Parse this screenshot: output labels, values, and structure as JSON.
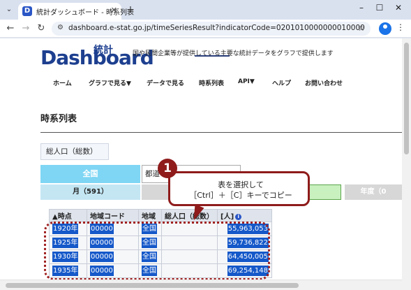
{
  "browser": {
    "tab_title": "統計ダッシュボード - 時系列表",
    "tab_favicon": "D",
    "url": "dashboard.e-stat.go.jp/timeSeriesResult?indicatorCode=0201010000000010000"
  },
  "site": {
    "logo_text": "Dashboard",
    "logo_kanji": "統計",
    "tagline": "国や民間企業等が提供している主要な統計データをグラフで提供します"
  },
  "nav": {
    "items": [
      "ホーム",
      "グラフで見る▼",
      "データで見る",
      "時系列表",
      "API▼",
      "ヘルプ",
      "お問い合わせ"
    ]
  },
  "main": {
    "section_title": "時系列表",
    "data_label": "総人口（総数）",
    "region_button": "全国",
    "pref_select": "都道",
    "period_tabs": [
      "月（591）",
      "",
      "",
      "年度（0"
    ]
  },
  "table": {
    "headers": [
      "▲時点",
      "地域コード",
      "地域",
      "総人口（総数）",
      "[人]"
    ],
    "rows": [
      [
        "1920年",
        "00000",
        "全国",
        "",
        "55,963,053"
      ],
      [
        "1925年",
        "00000",
        "全国",
        "",
        "59,736,822"
      ],
      [
        "1930年",
        "00000",
        "全国",
        "",
        "64,450,005"
      ],
      [
        "1935年",
        "00000",
        "全国",
        "",
        "69,254,148"
      ]
    ]
  },
  "callout": {
    "step": "1",
    "line1": "表を選択して",
    "line2": "［Ctrl］＋［C］キーでコピー"
  },
  "colors": {
    "accent": "#8f1b1b",
    "nation_button": "#7fd6f4",
    "selection": "#1558c9",
    "period_active": "#c9f0bf"
  }
}
